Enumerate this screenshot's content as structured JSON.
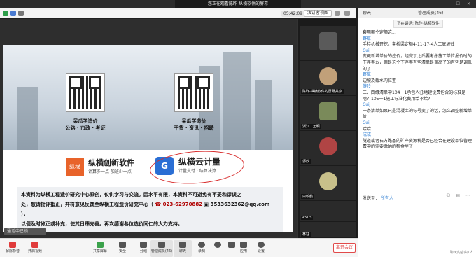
{
  "top_banner": {
    "viewing": "您正在观看陈昨-纵横软件的屏幕",
    "window_controls": "— ☐ ✕"
  },
  "meeting_toolbar": {
    "timer": "05:42:09",
    "view_button": "演讲者视图"
  },
  "slide": {
    "qr_left_caption_1": "呆瓜学造价",
    "qr_left_caption_2": "公路 · 市政 · 考证",
    "qr_right_caption_1": "呆瓜学造价",
    "qr_right_caption_2": "干货 · 资讯 · 招聘",
    "logo1_mark": "纵横",
    "logo1_title": "纵横创新软件",
    "logo1_sub": "计算多一点  加班少一点",
    "logo2_mark": "G",
    "logo2_title": "纵横云计量",
    "logo2_sub": "计量支付 · 结算决算",
    "notice_line1": "本资料为纵横工程造价研究中心原创，仅供学习与交流。因水平有限，本资料不可避免有不妥和谬误之",
    "notice_line2_a": "处，敬请批评指正，并将意见反馈至纵横工程造价研究中心（",
    "notice_phone": "023-62970882",
    "notice_qq": "3533632362@qq.com",
    "notice_line2_b": "），",
    "notice_line3": "以便及时修正或补充，使其日臻完善。再次感谢各位造价同仁的大力支持。",
    "bottom_tag": "通话中已锁"
  },
  "gallery": [
    {
      "name": "",
      "color": "#5a5a5a"
    },
    {
      "name": "陈昨-纵横软件的屏幕共享",
      "color": "#c1a079"
    },
    {
      "name": "浙江 · 王颖",
      "color": "#7a8a5a"
    },
    {
      "name": "郭欣",
      "color": "#b04444"
    },
    {
      "name": "白皎鹤",
      "color": "#c8c08a"
    },
    {
      "name": "ASUS",
      "color": "#3a3a3a"
    },
    {
      "name": "林钰",
      "color": "#6e6e6e"
    }
  ],
  "chat": {
    "header_chat": "聊天",
    "header_members": "管理成员(46)",
    "speaking": "正在讲话: 陈昨-纵横软件",
    "messages": [
      {
        "sender": "",
        "text": "套用哪个定额这..."
      },
      {
        "sender": "野草",
        "text": "手持机械开挖。套桥梁定额4-11-17-4人工底坡砼"
      },
      {
        "sender": "CuiJ",
        "text": "变更新增单价的控价，组完了之后要考虑施工单位报价时的下浮率么，但是这个下浮率有些清单是调高了的有些是调低的了"
      },
      {
        "sender": "野草",
        "text": "边坡及截水沟位置"
      },
      {
        "sender": "薛玲",
        "text": "三、四级清单中104一1承包人驻地建设费包含的标准是啥？105一1施工标准化费用给不给?"
      },
      {
        "sender": "CuiJ",
        "text": "一条清单如果只是混凝土的标号变了的话，怎么调整新增单价"
      },
      {
        "sender": "CuiJ",
        "text": "哈哈"
      },
      {
        "sender": "成成",
        "text": "隧道或者石方路基的矿产资源税是否已经合在建设单位管理费中的需要缴纳的税金里了"
      }
    ],
    "send_to_label": "发送至：",
    "send_to_value": "所有人",
    "placeholder": "",
    "footer_note": "聊天内容由1人"
  },
  "bottom_toolbar": {
    "buttons": [
      "解除静音",
      "开启视频",
      "共享屏幕",
      "安全",
      "分组",
      "管理成员(46)",
      "聊天",
      "录制",
      "",
      "应用",
      "设置"
    ],
    "leave": "离开会议"
  }
}
